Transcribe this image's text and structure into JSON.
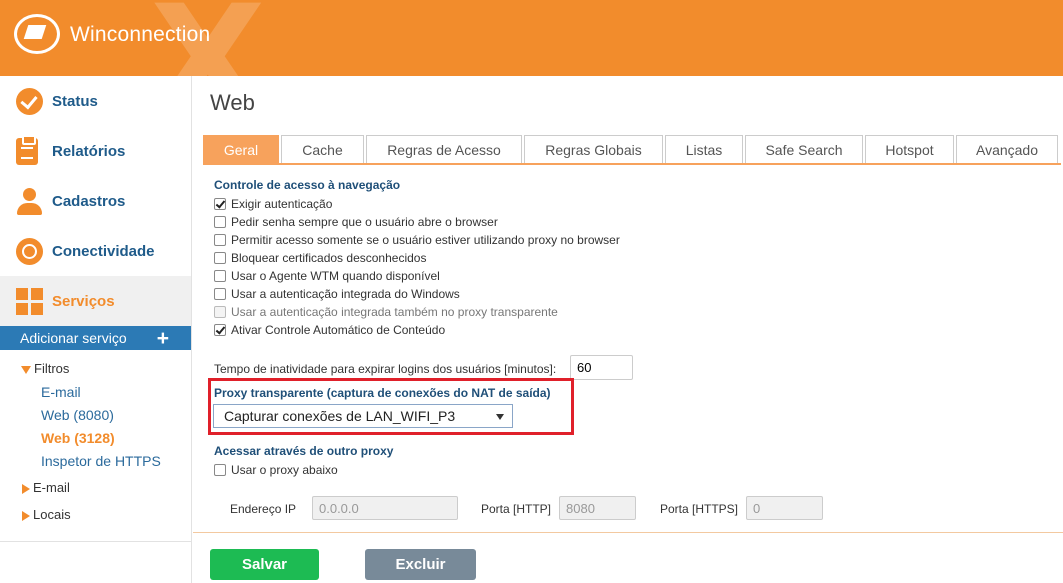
{
  "app": {
    "brand": "Winconnection"
  },
  "sidebar": {
    "nav": [
      {
        "label": "Status",
        "icon": "check-circle-icon"
      },
      {
        "label": "Relatórios",
        "icon": "clipboard-icon"
      },
      {
        "label": "Cadastros",
        "icon": "user-icon"
      },
      {
        "label": "Conectividade",
        "icon": "globe-icon"
      },
      {
        "label": "Serviços",
        "icon": "grid-icon",
        "active": true
      }
    ],
    "add_service": {
      "label": "Adicionar serviço",
      "plus": "+"
    },
    "tree": {
      "filtros": "Filtros",
      "filtros_children": [
        "E-mail",
        "Web (8080)",
        "Web (3128)",
        "Inspetor de HTTPS"
      ],
      "email": "E-mail",
      "locais": "Locais"
    }
  },
  "main": {
    "title": "Web",
    "tabs": [
      "Geral",
      "Cache",
      "Regras de Acesso",
      "Regras Globais",
      "Listas",
      "Safe Search",
      "Hotspot",
      "Avançado"
    ],
    "active_tab": "Geral",
    "access_control": {
      "title": "Controle de acesso à navegação",
      "options": [
        {
          "label": "Exigir autenticação",
          "checked": true,
          "disabled": false
        },
        {
          "label": "Pedir senha sempre que o usuário abre o browser",
          "checked": false,
          "disabled": false
        },
        {
          "label": "Permitir acesso somente se o usuário estiver utilizando proxy no browser",
          "checked": false,
          "disabled": false
        },
        {
          "label": "Bloquear certificados desconhecidos",
          "checked": false,
          "disabled": false
        },
        {
          "label": "Usar o Agente WTM quando disponível",
          "checked": false,
          "disabled": false
        },
        {
          "label": "Usar a autenticação integrada do Windows",
          "checked": false,
          "disabled": false
        },
        {
          "label": "Usar a autenticação integrada também no proxy transparente",
          "checked": false,
          "disabled": true
        },
        {
          "label": "Ativar Controle Automático de Conteúdo",
          "checked": true,
          "disabled": false
        }
      ]
    },
    "timeout": {
      "label": "Tempo de inatividade para expirar logins dos usuários [minutos]:",
      "value": "60"
    },
    "transparent_proxy": {
      "title": "Proxy transparente (captura de conexões do NAT de saída)",
      "selected": "Capturar conexões de LAN_WIFI_P3"
    },
    "other_proxy": {
      "title": "Acessar através de outro proxy",
      "use_label": "Usar o proxy abaixo",
      "ip_label": "Endereço IP",
      "ip_value": "0.0.0.0",
      "http_label": "Porta [HTTP]",
      "http_value": "8080",
      "https_label": "Porta [HTTPS]",
      "https_value": "0"
    },
    "buttons": {
      "save": "Salvar",
      "delete": "Excluir"
    }
  },
  "colors": {
    "accent": "#f28c2c",
    "nav_blue": "#2c7ab5",
    "save": "#1dbb53",
    "delete": "#788a99",
    "highlight": "#e0202a"
  }
}
